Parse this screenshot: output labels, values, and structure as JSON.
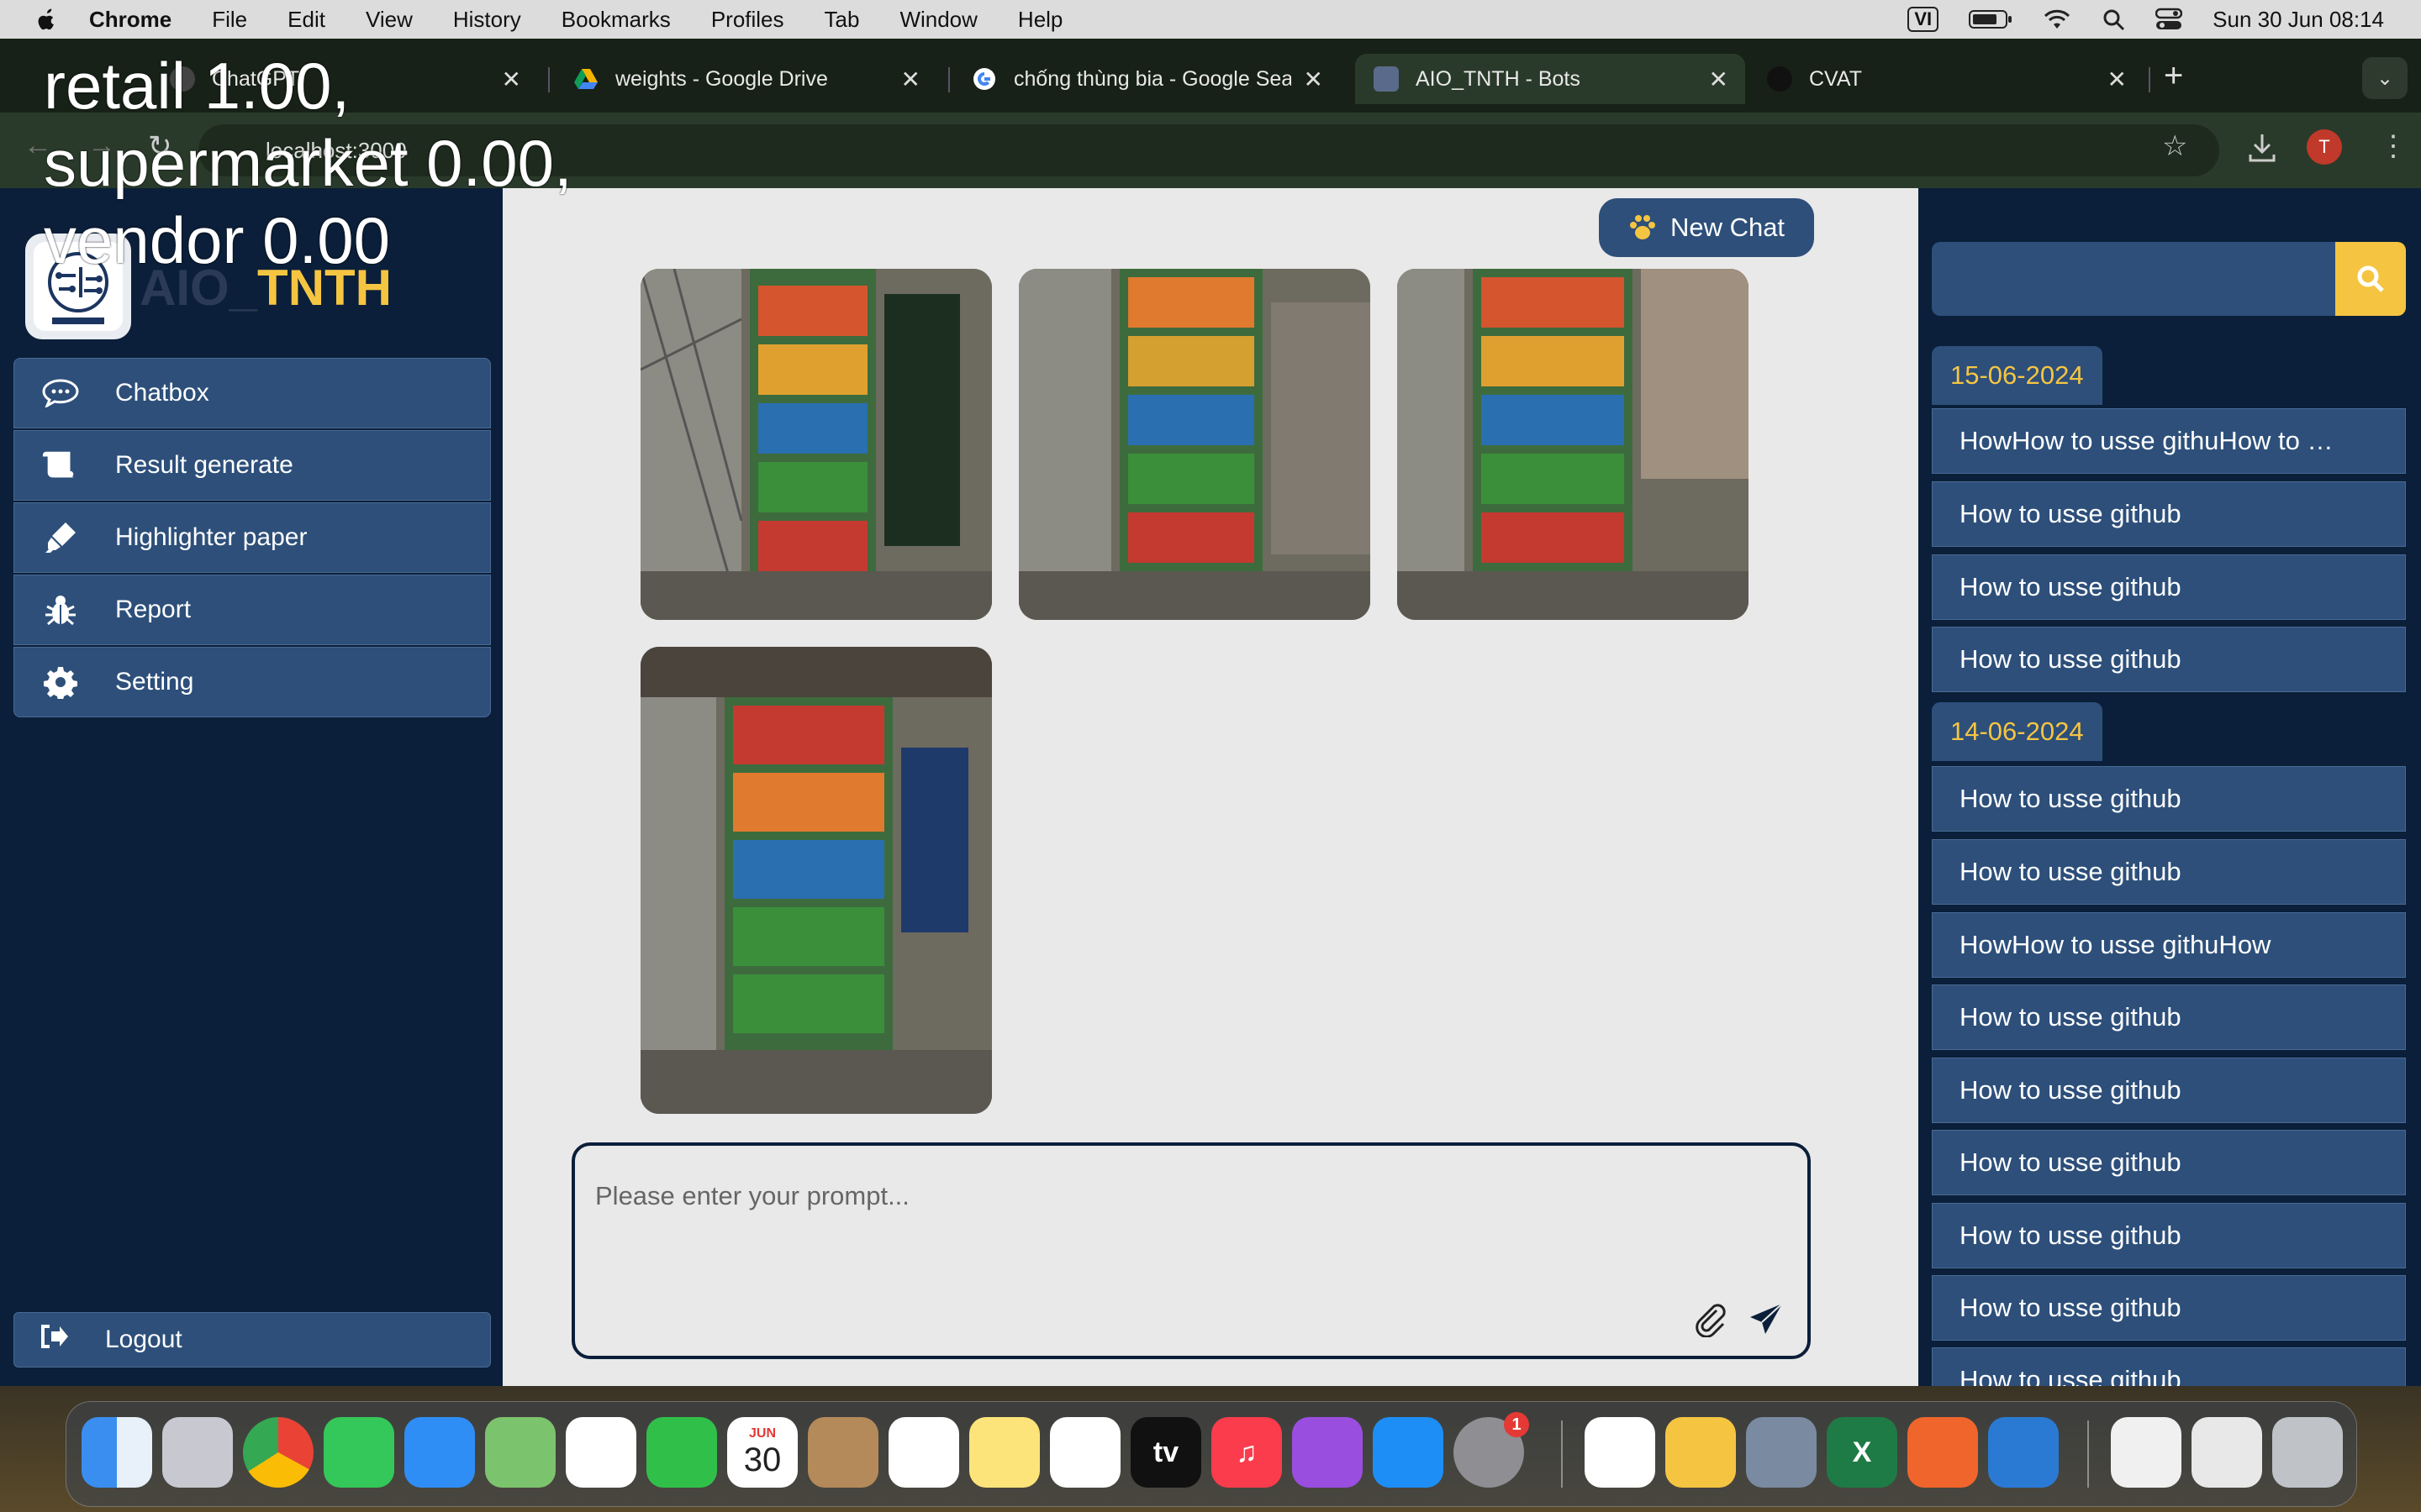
{
  "menubar": {
    "app_name": "Chrome",
    "items": [
      "File",
      "Edit",
      "View",
      "History",
      "Bookmarks",
      "Profiles",
      "Tab",
      "Window",
      "Help"
    ],
    "input_source": "VI",
    "datetime": "Sun 30 Jun  08:14"
  },
  "overlay_text": {
    "line1": "retail 1.00,",
    "line2": "supermarket 0.00,",
    "line3": "vendor 0.00"
  },
  "browser": {
    "tabs": [
      {
        "title": "ChatGPT",
        "icon": "chatgpt-icon"
      },
      {
        "title": "weights - Google Drive",
        "icon": "google-drive-icon"
      },
      {
        "title": "chống thùng bia - Google Sea",
        "icon": "google-icon"
      },
      {
        "title": "AIO_TNTH - Bots",
        "icon": "bot-icon",
        "active": true
      },
      {
        "title": "CVAT",
        "icon": "cvat-icon"
      }
    ],
    "url": "localhost:3000",
    "profile_initial": "T"
  },
  "sidebar": {
    "brand_prefix": "AIO_",
    "brand_highlight": "TNTH",
    "items": [
      {
        "label": "Chatbox",
        "icon": "chat-bubble-icon"
      },
      {
        "label": "Result generate",
        "icon": "scroll-icon"
      },
      {
        "label": "Highlighter paper",
        "icon": "highlighter-icon"
      },
      {
        "label": "Report",
        "icon": "bug-icon"
      },
      {
        "label": "Setting",
        "icon": "gear-icon"
      }
    ],
    "logout_label": "Logout"
  },
  "main": {
    "new_chat_label": "New Chat",
    "prompt_placeholder": "Please enter your prompt..."
  },
  "history": {
    "search_value": "",
    "groups": [
      {
        "date": "15-06-2024",
        "items": [
          "HowHow to usse githuHow to …",
          "How to usse github",
          "How to usse github",
          "How to usse github"
        ]
      },
      {
        "date": "14-06-2024",
        "items": [
          "How to usse github",
          "How to usse github",
          "HowHow to usse githuHow",
          "How to usse github",
          "How to usse github",
          "How to usse github",
          "How to usse github",
          "How to usse github",
          "How to usse github"
        ]
      }
    ]
  },
  "dock": {
    "calendar_month": "JUN",
    "calendar_day": "30",
    "settings_badge": "1",
    "tv_label": "tv"
  }
}
